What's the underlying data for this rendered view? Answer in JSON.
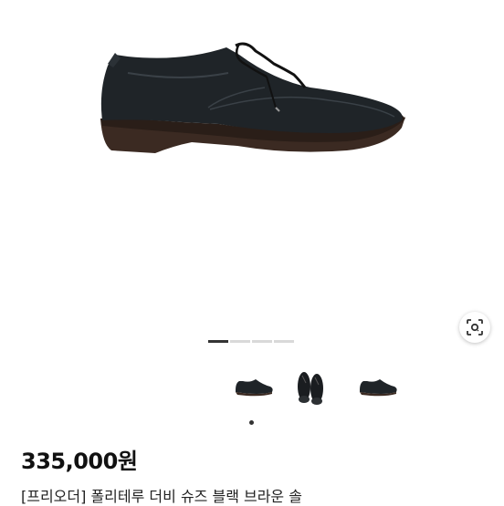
{
  "product": {
    "price": "335,000원",
    "title": "[프리오더] 폴리테루 더비 슈즈 블랙 브라운 솔"
  },
  "gallery": {
    "image_count": 4,
    "active_index": 0,
    "thumbnails": [
      "shoe-side-thumbnail",
      "shoe-front-pair-thumbnail",
      "shoe-side-thumbnail-2"
    ]
  },
  "colors": {
    "shoe_upper": "#1f2428",
    "sole": "#3b2a22",
    "pager_active": "#333333",
    "pager_inactive": "#d9d9d9"
  },
  "icons": {
    "lens": "image-search-lens-icon"
  }
}
